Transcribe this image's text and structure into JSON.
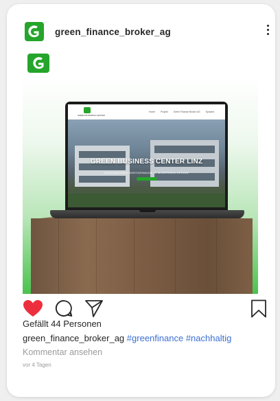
{
  "post": {
    "username": "green_finance_broker_ag",
    "likes_text": "Gefällt 44 Personen",
    "caption_user": "green_finance_broker_ag",
    "hashtags": [
      "#greenfinance",
      "#nachhaltig"
    ],
    "view_comments": "Kommentar ansehen",
    "time_ago": "vor 4 Tagen"
  },
  "media": {
    "site_logo_text": "GREEN BUSINESS CENTER",
    "site_menu": [
      "Home",
      "Projekt",
      "Green Finance Broker AG",
      "Sprache"
    ],
    "hero_title": "GREEN BUSINESS CENTER LINZ",
    "hero_subtitle": "NACHHALTIGES BÜROGEBÄUDE IN MODERNEM DESIGN"
  },
  "colors": {
    "brand_green": "#25a52b",
    "like_red": "#ed2f3d",
    "hashtag_blue": "#3b6fd1"
  },
  "icons": [
    "company-logo-icon",
    "more-options-icon",
    "heart-icon",
    "comment-icon",
    "share-icon",
    "bookmark-icon"
  ]
}
